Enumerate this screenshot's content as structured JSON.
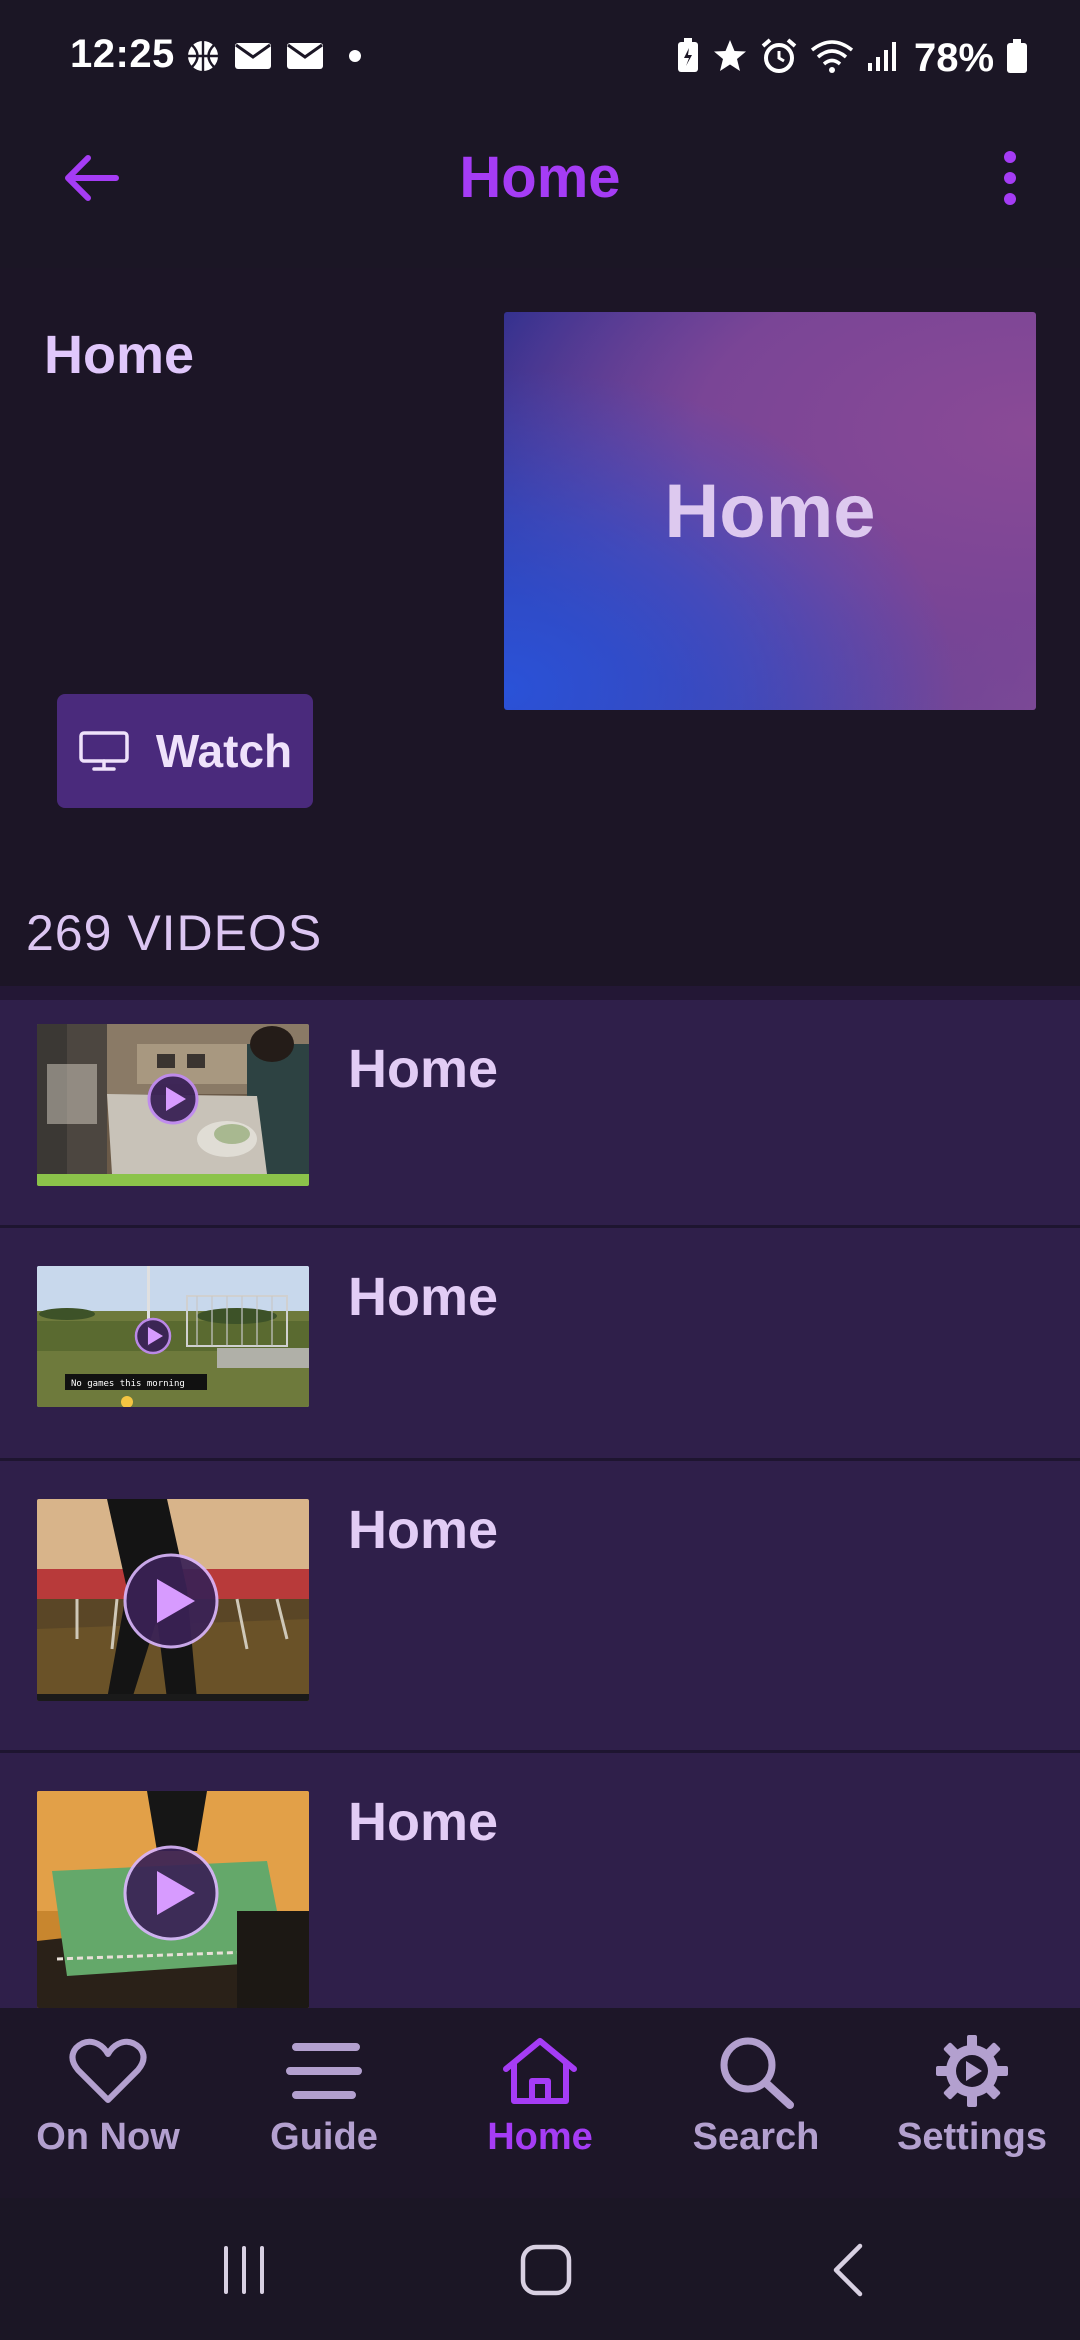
{
  "status_bar": {
    "time": "12:25",
    "battery": "78%",
    "left_icons": [
      "basketball-icon",
      "mail-icon",
      "mail-icon",
      "dot-icon"
    ],
    "right_icons": [
      "battery-saver-icon",
      "star-icon",
      "alarm-icon",
      "wifi-icon",
      "signal-icon",
      "battery-icon"
    ]
  },
  "app_bar": {
    "title": "Home"
  },
  "header": {
    "channel_name": "Home",
    "hero_text": "Home",
    "watch_label": "Watch",
    "video_count": "269 VIDEOS"
  },
  "videos": [
    {
      "title": "Home"
    },
    {
      "title": "Home"
    },
    {
      "title": "Home"
    },
    {
      "title": "Home"
    }
  ],
  "bottom_nav": {
    "items": [
      {
        "label": "On Now",
        "icon": "heart-icon"
      },
      {
        "label": "Guide",
        "icon": "menu-icon"
      },
      {
        "label": "Home",
        "icon": "home-icon",
        "active": true
      },
      {
        "label": "Search",
        "icon": "search-icon"
      },
      {
        "label": "Settings",
        "icon": "gear-icon"
      }
    ]
  },
  "colors": {
    "accent": "#a53cf5",
    "background": "#1b1625",
    "list_background": "#2f1f4a",
    "button_background": "#4a2a7c",
    "progress": "#8bc34a"
  }
}
